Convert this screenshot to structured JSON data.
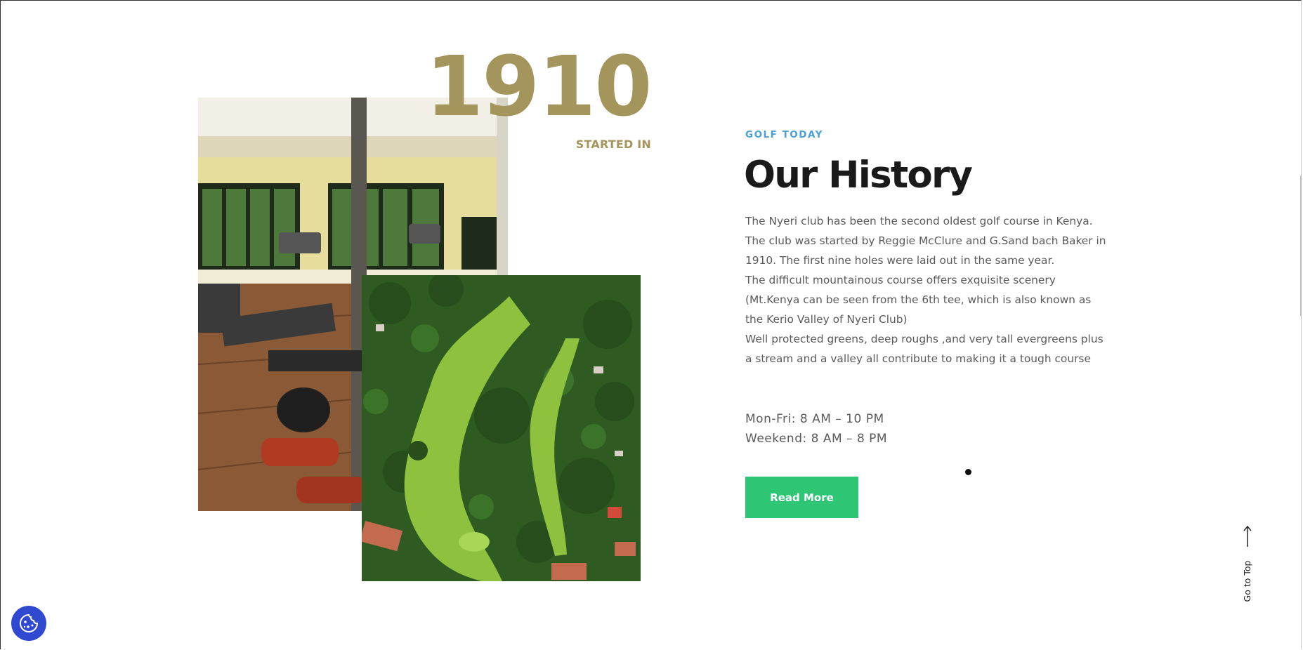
{
  "history": {
    "year": "1910",
    "started_label": "STARTED IN",
    "eyebrow": "GOLF TODAY",
    "title": "Our History",
    "paragraphs": [
      "The Nyeri club has been the second oldest golf course in Kenya. The club was started by Reggie McClure and G.Sand bach Baker in 1910. The first nine holes were laid out in the same year.",
      "The difficult mountainous course offers exquisite scenery (Mt.Kenya can be seen from the 6th tee, which is also known as the Kerio Valley of Nyeri Club)",
      "Well protected greens, deep roughs ,and very tall evergreens plus a stream and a valley all contribute to making it a tough course"
    ],
    "hours": {
      "weekdays": "Mon-Fri: 8 AM – 10 PM",
      "weekend": "Weekend: 8 AM – 8 PM"
    },
    "read_more_label": "Read More"
  },
  "go_top_label": "Go to Top",
  "icons": {
    "cookie": "cookie-icon",
    "arrow_up": "arrow-up-icon"
  },
  "colors": {
    "accent_gold": "#a3955c",
    "eyebrow_blue": "#4a9fd6",
    "button_green": "#2ec574",
    "cookie_blue": "#2f49d1"
  }
}
